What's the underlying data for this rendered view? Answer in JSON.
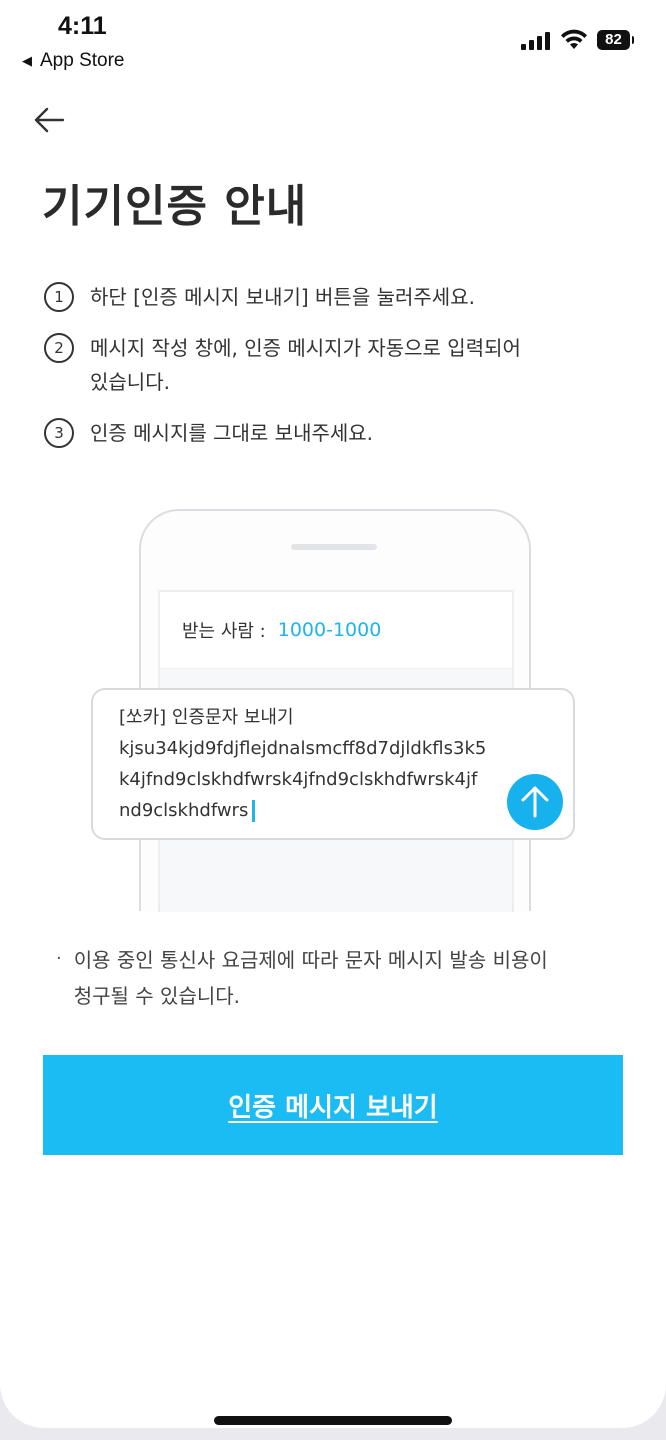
{
  "status_bar": {
    "time": "4:11",
    "back_app": "App Store",
    "battery": "82"
  },
  "header": {
    "title": "기기인증 안내"
  },
  "steps": [
    {
      "num": "1",
      "text": "하단 [인증 메시지 보내기] 버튼을 눌러주세요."
    },
    {
      "num": "2",
      "text_line1": "메시지 작성 창에, 인증 메시지가 자동으로 입력되어",
      "text_line2": "있습니다."
    },
    {
      "num": "3",
      "text": "인증 메시지를 그대로 보내주세요."
    }
  ],
  "illustration": {
    "recipient_label": "받는 사람 :",
    "recipient_number": "1000-1000",
    "message_lines": [
      "[쏘카] 인증문자 보내기",
      "kjsu34kjd9fdjflejdnalsmcff8d7djldkfls3k5",
      "k4jfnd9clskhdfwrsk4jfnd9clskhdfwrsk4jf",
      "nd9clskhdfwrs"
    ]
  },
  "notice": {
    "line1": "이용 중인 통신사 요금제에 따라 문자 메시지 발송 비용이",
    "line2": "청구될 수 있습니다."
  },
  "cta": {
    "label": "인증 메시지 보내기"
  },
  "colors": {
    "accent": "#1bbbf3",
    "recipient_number": "#1eb6ea"
  }
}
